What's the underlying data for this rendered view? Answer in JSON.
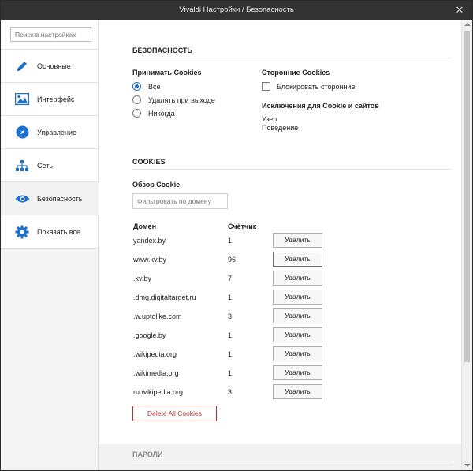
{
  "window": {
    "title": "Vivaldi Настройки / Безопасность",
    "close": "✕"
  },
  "sidebar": {
    "search_placeholder": "Поиск в настройках",
    "items": [
      {
        "label": "Основные",
        "icon": "pencil-icon"
      },
      {
        "label": "Интерфейс",
        "icon": "image-icon"
      },
      {
        "label": "Управление",
        "icon": "compass-icon"
      },
      {
        "label": "Сеть",
        "icon": "network-icon"
      },
      {
        "label": "Безопасность",
        "icon": "eye-icon"
      },
      {
        "label": "Показать все",
        "icon": "gear-icon"
      }
    ],
    "active_index": 4
  },
  "security": {
    "section_title": "БЕЗОПАСНОСТЬ",
    "accept_cookies": {
      "label": "Принимать Cookies",
      "options": [
        "Все",
        "Удалять при выходе",
        "Никогда"
      ],
      "selected": 0
    },
    "third_party": {
      "label": "Сторонние Cookies",
      "checkbox_label": "Блокировать сторонние",
      "checked": false
    },
    "exceptions": {
      "label": "Исключения для Cookie и сайтов",
      "col1": "Узел",
      "col2": "Поведение"
    }
  },
  "cookies": {
    "section_title": "COOKIES",
    "overview_label": "Обзор Cookie",
    "filter_placeholder": "Фильтровать по домену",
    "headers": {
      "domain": "Домен",
      "count": "Счётчик"
    },
    "delete_label": "Удалить",
    "rows": [
      {
        "domain": "yandex.by",
        "count": "1"
      },
      {
        "domain": "www.kv.by",
        "count": "96"
      },
      {
        "domain": ".kv.by",
        "count": "7"
      },
      {
        "domain": ".dmg.digitaltarget.ru",
        "count": "1"
      },
      {
        "domain": ".w.uptolike.com",
        "count": "3"
      },
      {
        "domain": ".google.by",
        "count": "1"
      },
      {
        "domain": ".wikipedia.org",
        "count": "1"
      },
      {
        "domain": ".wikimedia.org",
        "count": "1"
      },
      {
        "domain": "ru.wikipedia.org",
        "count": "3"
      }
    ],
    "delete_all_label": "Delete All Cookies"
  },
  "passwords": {
    "section_title": "ПАРОЛИ"
  }
}
